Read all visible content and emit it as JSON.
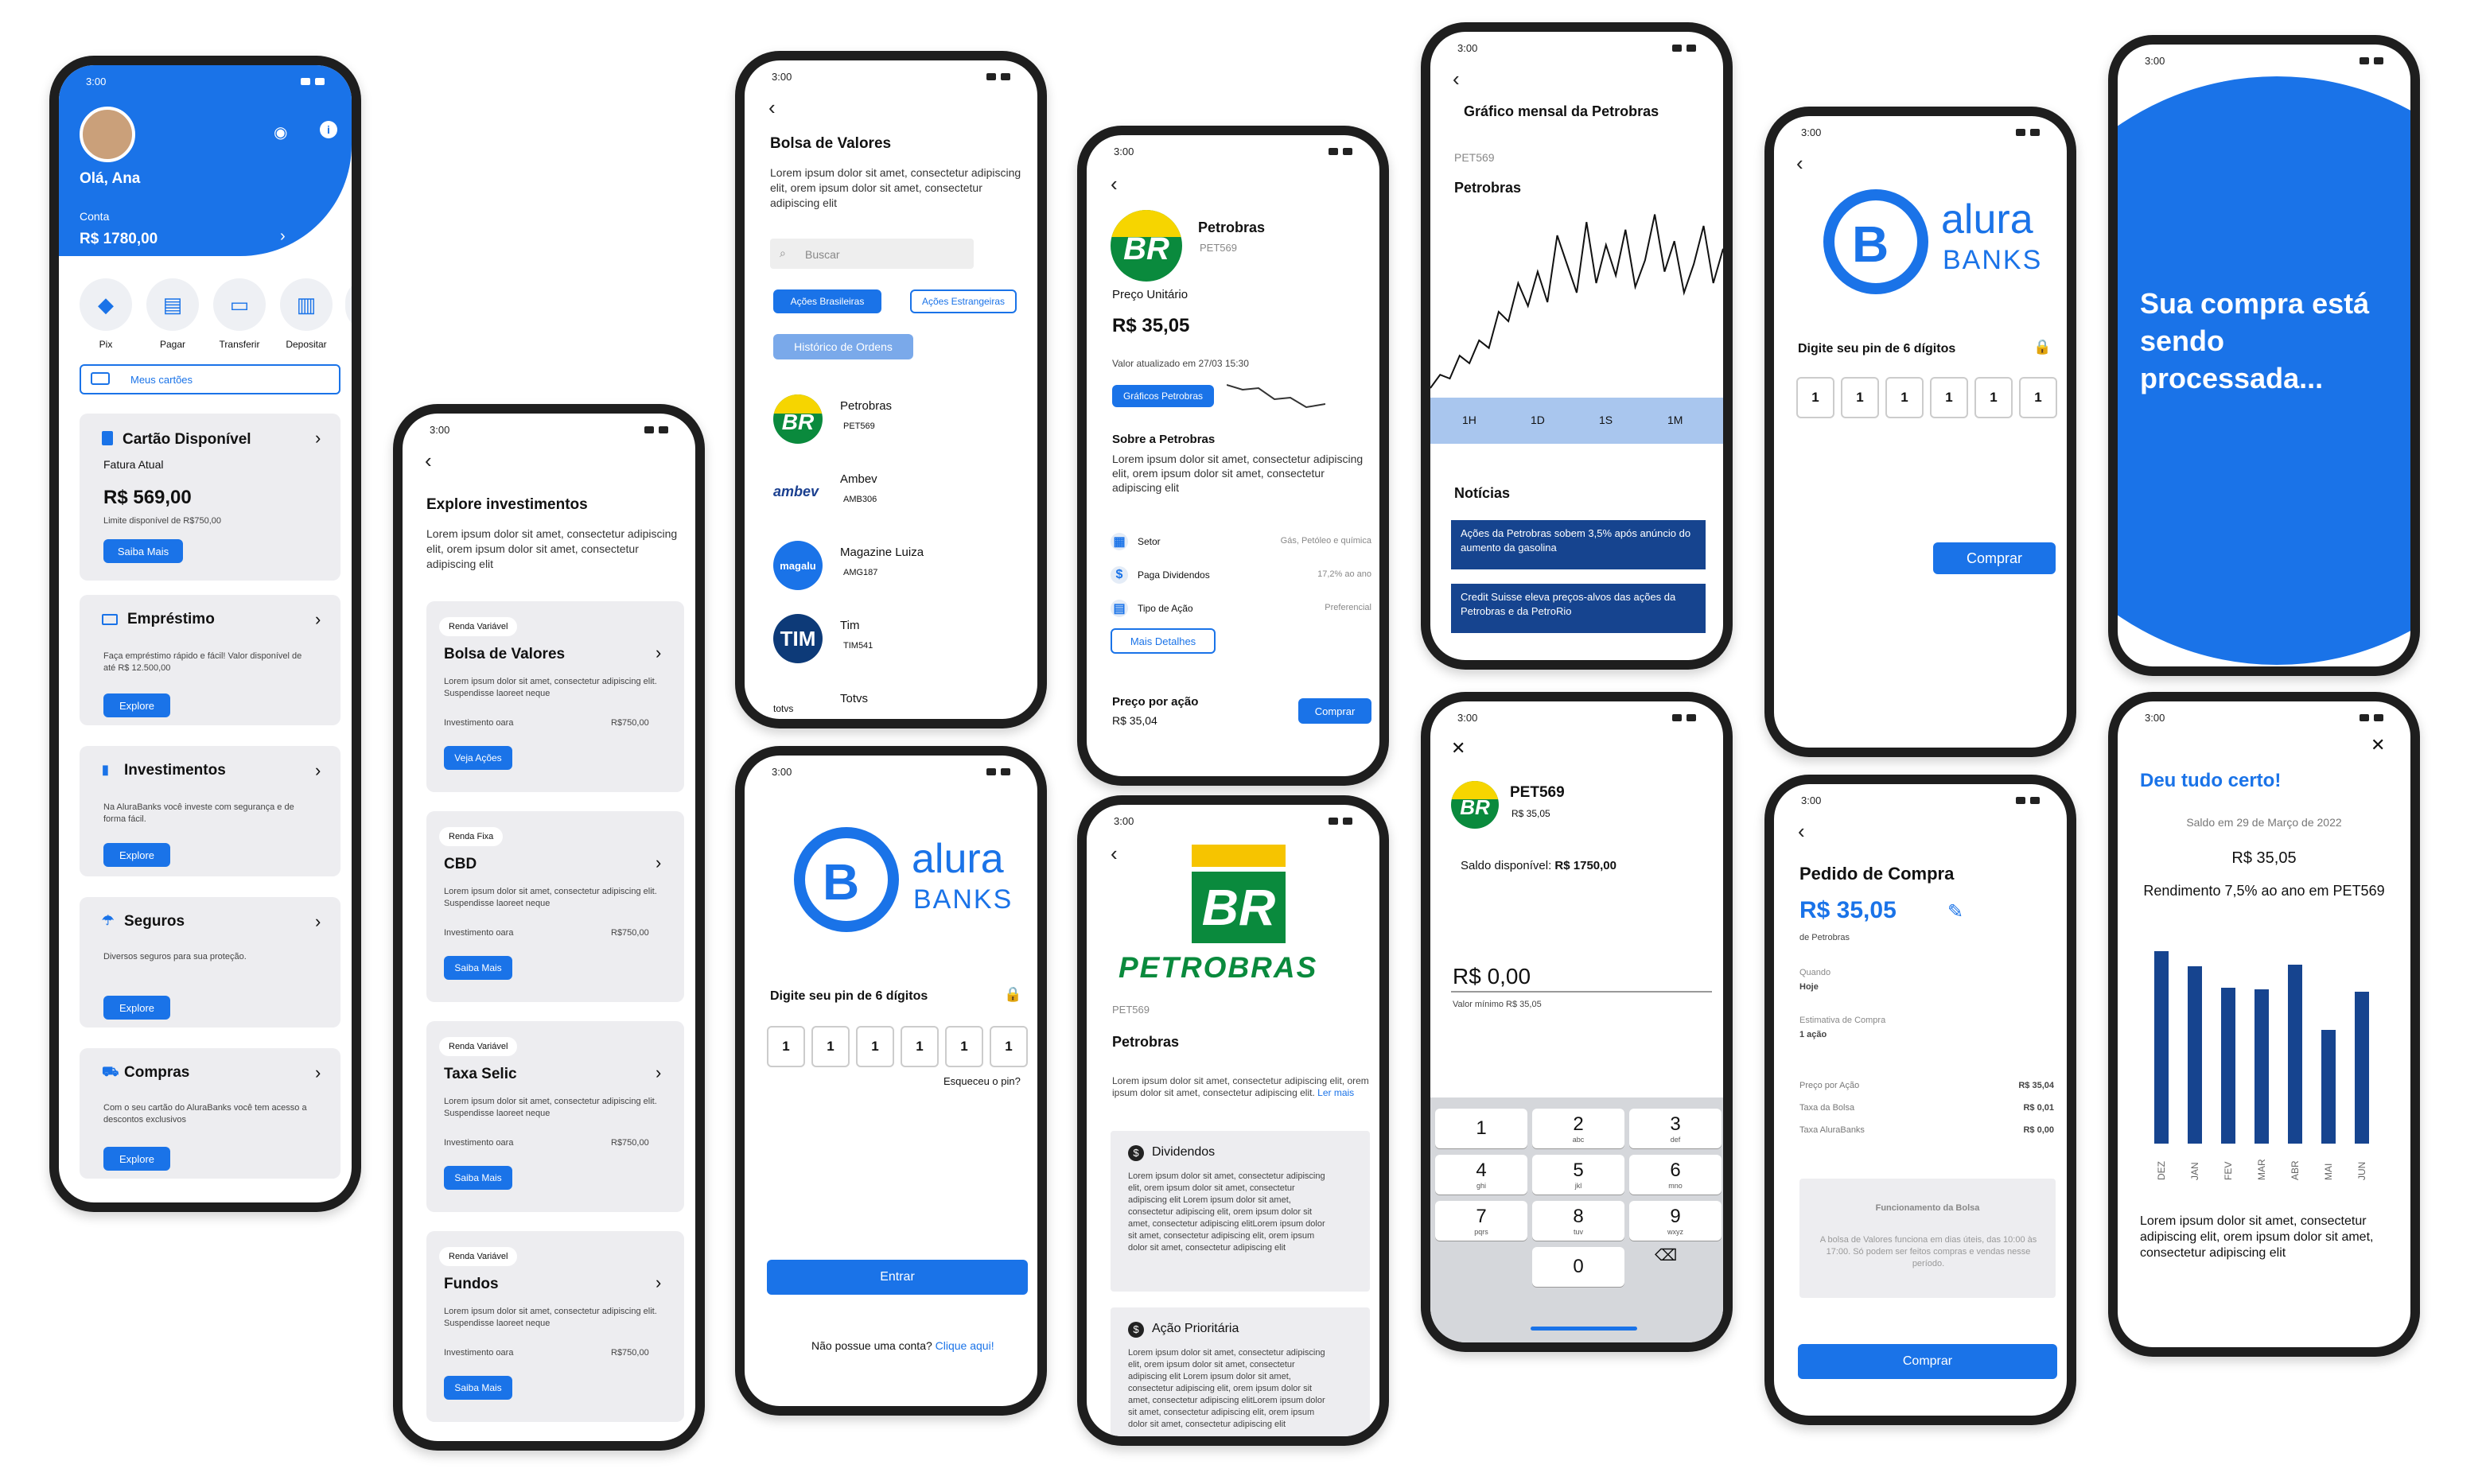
{
  "status_time": "3:00",
  "p1": {
    "greeting": "Olá, Ana",
    "account_label": "Conta",
    "balance": "R$ 1780,00",
    "actions": [
      {
        "label": "Pix",
        "icon": "pix-icon"
      },
      {
        "label": "Pagar",
        "icon": "pay-icon"
      },
      {
        "label": "Transferir",
        "icon": "transfer-icon"
      },
      {
        "label": "Depositar",
        "icon": "deposit-icon"
      }
    ],
    "cards_btn": "Meus cartões",
    "c1": {
      "title": "Cartão Disponível",
      "sub": "Fatura Atual",
      "value": "R$ 569,00",
      "limit": "Limite disponível de R$750,00",
      "btn": "Saiba Mais"
    },
    "c2": {
      "title": "Empréstimo",
      "text": "Faça empréstimo rápido e fácil! Valor disponível de até R$ 12.500,00",
      "btn": "Explore"
    },
    "c3": {
      "title": "Investimentos",
      "text": "Na AluraBanks você investe com segurança e de forma fácil.",
      "btn": "Explore"
    },
    "c4": {
      "title": "Seguros",
      "text": "Diversos seguros para sua proteção.",
      "btn": "Explore"
    },
    "c5": {
      "title": "Compras",
      "text": "Com o seu cartão do AluraBanks você tem acesso a descontos exclusivos",
      "btn": "Explore"
    }
  },
  "p2": {
    "title": "Explore investimentos",
    "lorem": "Lorem ipsum dolor sit amet, consectetur adipiscing elit, orem ipsum dolor sit amet, consectetur adipiscing elit",
    "cards": [
      {
        "tag": "Renda Variável",
        "title": "Bolsa de Valores",
        "text": "Lorem ipsum dolor sit amet, consectetur adipiscing elit. Suspendisse laoreet neque",
        "inv": "Investimento oara",
        "val": "R$750,00",
        "btn": "Veja Ações"
      },
      {
        "tag": "Renda Fixa",
        "title": "CBD",
        "text": "Lorem ipsum dolor sit amet, consectetur adipiscing elit. Suspendisse laoreet neque",
        "inv": "Investimento oara",
        "val": "R$750,00",
        "btn": "Saiba Mais"
      },
      {
        "tag": "Renda Variável",
        "title": "Taxa Selic",
        "text": "Lorem ipsum dolor sit amet, consectetur adipiscing elit. Suspendisse laoreet neque",
        "inv": "Investimento oara",
        "val": "R$750,00",
        "btn": "Saiba Mais"
      },
      {
        "tag": "Renda Variável",
        "title": "Fundos",
        "text": "Lorem ipsum dolor sit amet, consectetur adipiscing elit. Suspendisse laoreet neque",
        "inv": "Investimento oara",
        "val": "R$750,00",
        "btn": "Saiba Mais"
      }
    ]
  },
  "p3": {
    "title": "Bolsa de Valores",
    "lorem": "Lorem ipsum dolor sit amet, consectetur adipiscing elit, orem ipsum dolor sit amet, consectetur adipiscing elit",
    "search": "Buscar",
    "tab1": "Ações Brasileiras",
    "tab2": "Ações Estrangeiras",
    "hist": "Histórico de Ordens",
    "stocks": [
      {
        "name": "Petrobras",
        "code": "PET569"
      },
      {
        "name": "Ambev",
        "code": "AMB306",
        "logo": "ambev"
      },
      {
        "name": "Magazine Luiza",
        "code": "AMG187",
        "logo": "magalu"
      },
      {
        "name": "Tim",
        "code": "TIM541",
        "logo": "TIM"
      },
      {
        "name": "Totvs",
        "code": "",
        "logo": "totvs"
      }
    ]
  },
  "p4": {
    "pin_label": "Digite seu pin de 6 dígitos",
    "pins": [
      "1",
      "1",
      "1",
      "1",
      "1",
      "1"
    ],
    "forgot": "Esqueceu o pin?",
    "enter": "Entrar",
    "noacc": "Não possue uma conta?",
    "link": "Clique aqui!",
    "logo_a": "alura",
    "logo_b": "BANKS"
  },
  "p5": {
    "name": "Petrobras",
    "code": "PET569",
    "unit_label": "Preço Unitário",
    "price": "R$ 35,05",
    "updated": "Valor atualizado em 27/03 15:30",
    "chart_btn": "Gráficos Petrobras",
    "about": "Sobre a Petrobras",
    "lorem": "Lorem ipsum dolor sit amet, consectetur adipiscing elit, orem ipsum dolor sit amet, consectetur adipiscing elit",
    "rows": [
      {
        "k": "Setor",
        "v": "Gás, Petóleo e química"
      },
      {
        "k": "Paga Dividendos",
        "v": "17,2% ao ano"
      },
      {
        "k": "Tipo de Ação",
        "v": "Preferencial"
      }
    ],
    "more": "Mais Detalhes",
    "ppa": "Preço por ação",
    "ppa_val": "R$ 35,04",
    "buy": "Comprar"
  },
  "p6": {
    "code": "PET569",
    "name": "Petrobras",
    "brand": "PETROBRAS",
    "lorem": "Lorem ipsum dolor sit amet, consectetur adipiscing elit, orem ipsum dolor sit amet, consectetur adipiscing elit.",
    "more": "Ler mais",
    "s1": "Dividendos",
    "s2": "Ação Prioritária",
    "long": "Lorem ipsum dolor sit amet, consectetur adipiscing elit, orem ipsum dolor sit amet, consectetur adipiscing elit Lorem ipsum dolor sit amet, consectetur adipiscing elit, orem ipsum dolor sit amet, consectetur adipiscing elitLorem ipsum dolor sit amet, consectetur adipiscing elit, orem ipsum dolor sit amet, consectetur adipiscing elit"
  },
  "p7": {
    "title": "Gráfico mensal da Petrobras",
    "code": "PET569",
    "name": "Petrobras",
    "ranges": [
      "1H",
      "1D",
      "1S",
      "1M"
    ],
    "news_title": "Notícias",
    "n1": "Ações da Petrobras sobem 3,5% após anúncio do aumento da gasolina",
    "n2": "Credit Suisse eleva preços-alvos das ações da Petrobras e da PetroRio"
  },
  "p8": {
    "code": "PET569",
    "price": "R$ 35,05",
    "saldo_label": "Saldo disponível:",
    "saldo": "R$ 1750,00",
    "amount": "R$ 0,00",
    "min": "Valor mínimo R$ 35,05",
    "keys": [
      {
        "n": "1",
        "l": ""
      },
      {
        "n": "2",
        "l": "abc"
      },
      {
        "n": "3",
        "l": "def"
      },
      {
        "n": "4",
        "l": "ghi"
      },
      {
        "n": "5",
        "l": "jkl"
      },
      {
        "n": "6",
        "l": "mno"
      },
      {
        "n": "7",
        "l": "pqrs"
      },
      {
        "n": "8",
        "l": "tuv"
      },
      {
        "n": "9",
        "l": "wxyz"
      },
      {
        "n": "0",
        "l": ""
      }
    ]
  },
  "p9": {
    "pin_label": "Digite seu pin de 6 dígitos",
    "pins": [
      "1",
      "1",
      "1",
      "1",
      "1",
      "1"
    ],
    "buy": "Comprar",
    "logo_a": "alura",
    "logo_b": "BANKS"
  },
  "p10": {
    "title": "Pedido de Compra",
    "price": "R$ 35,05",
    "of": "de Petrobras",
    "when_l": "Quando",
    "when": "Hoje",
    "est_l": "Estimativa de Compra",
    "est": "1 ação",
    "fees": [
      {
        "k": "Preço por Ação",
        "v": "R$ 35,04"
      },
      {
        "k": "Taxa da Bolsa",
        "v": "R$ 0,01"
      },
      {
        "k": "Taxa AluraBanks",
        "v": "R$ 0,00"
      }
    ],
    "info_t": "Funcionamento da Bolsa",
    "info": "A bolsa de Valores funciona em dias úteis, das 10:00 às 17:00. Só podem ser feitos compras e vendas nesse período.",
    "buy": "Comprar"
  },
  "p11": {
    "msg": "Sua compra está sendo processada..."
  },
  "p12": {
    "title": "Deu tudo certo!",
    "saldo": "Saldo em 29 de Março de 2022",
    "value": "R$ 35,05",
    "rend": "Rendimento 7,5% ao ano em PET569",
    "lorem": "Lorem ipsum dolor sit amet, consectetur adipiscing elit, orem ipsum dolor sit amet, consectetur adipiscing elit"
  },
  "chart_data": [
    {
      "type": "line",
      "title": "Gráfico mensal da Petrobras",
      "series": [
        {
          "name": "Petrobras",
          "values": [
            5,
            12,
            10,
            22,
            18,
            30,
            26,
            45,
            40,
            60,
            48,
            66,
            50,
            85,
            70,
            55,
            92,
            60,
            80,
            64,
            88,
            58,
            72,
            96,
            66,
            82,
            55,
            70,
            90,
            60,
            78
          ]
        }
      ]
    },
    {
      "type": "bar",
      "categories": [
        "DEZ",
        "JAN",
        "FEV",
        "MAR",
        "ABR",
        "MAI",
        "JUN"
      ],
      "values": [
        100,
        92,
        81,
        80,
        93,
        59,
        79
      ],
      "ylim": [
        0,
        100
      ]
    }
  ]
}
